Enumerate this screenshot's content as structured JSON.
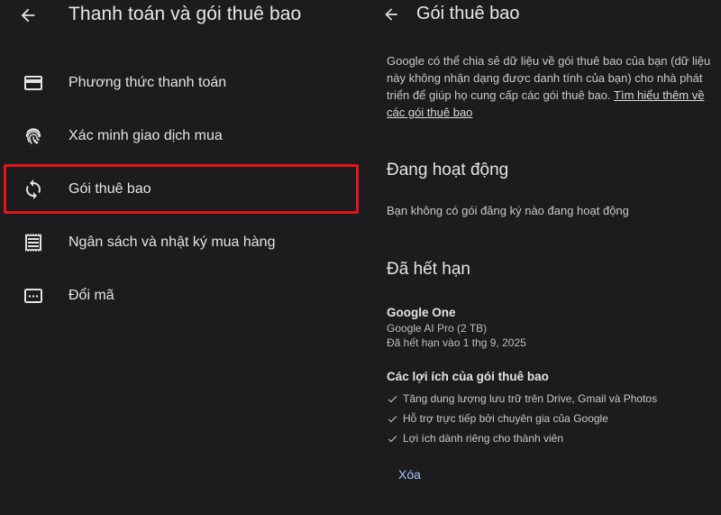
{
  "left_panel": {
    "title": "Thanh toán và gói thuê bao",
    "menu": [
      {
        "label": "Phương thức thanh toán",
        "icon": "credit-card-icon"
      },
      {
        "label": "Xác minh giao dịch mua",
        "icon": "fingerprint-icon"
      },
      {
        "label": "Gói thuê bao",
        "icon": "sync-icon"
      },
      {
        "label": "Ngân sách và nhật ký mua hàng",
        "icon": "receipt-icon"
      },
      {
        "label": "Đổi mã",
        "icon": "redeem-code-icon"
      }
    ],
    "highlight_color": "#e5141b"
  },
  "right_panel": {
    "title": "Gói thuê bao",
    "intro_text": "Google có thể chia sẻ dữ liệu về gói thuê bao của bạn (dữ liệu này không nhận dạng được danh tính của bạn) cho nhà phát triển để giúp họ cung cấp các gói thuê bao. ",
    "intro_link": "Tìm hiểu thêm về các gói thuê bao",
    "active_heading": "Đang hoạt động",
    "active_empty": "Bạn không có gói đăng ký nào đang hoạt động",
    "expired_heading": "Đã hết hạn",
    "subscription": {
      "name": "Google One",
      "plan": "Google AI Pro (2 TB)",
      "expired_on": "Đã hết hạn vào 1 thg 9, 2025"
    },
    "benefits_heading": "Các lợi ích của gói thuê bao",
    "benefits": [
      "Tăng dung lượng lưu trữ trên Drive, Gmail và Photos",
      "Hỗ trợ trực tiếp bởi chuyên gia của Google",
      "Lợi ích dành riêng cho thành viên"
    ],
    "delete_label": "Xóa",
    "link_color": "#a8c7fa"
  }
}
